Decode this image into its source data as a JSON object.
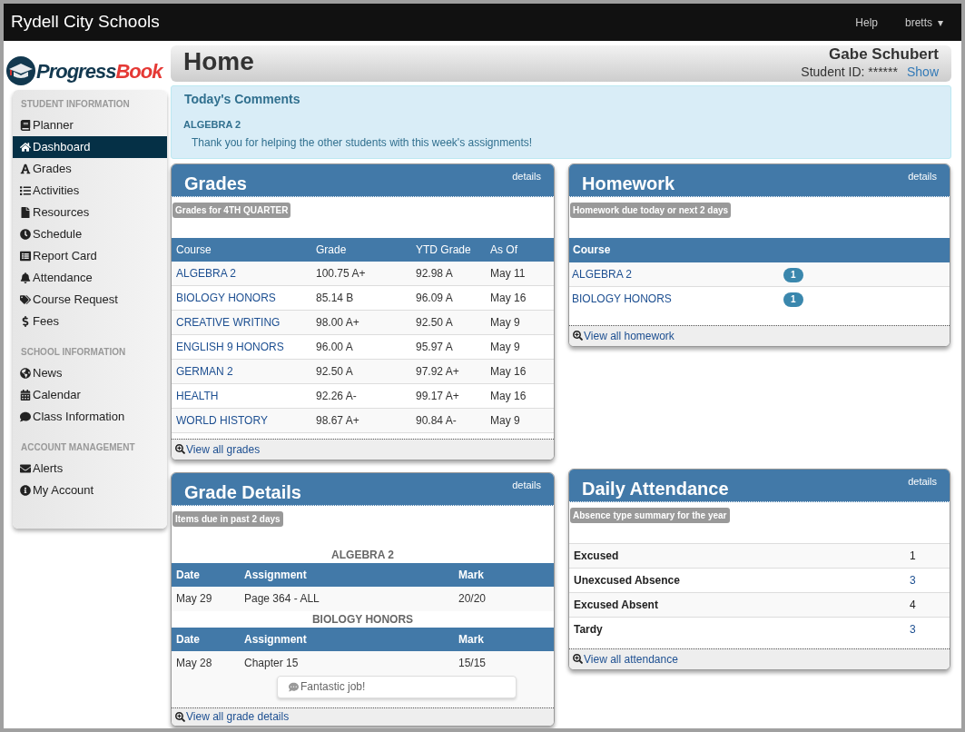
{
  "topbar": {
    "title": "Rydell City Schools",
    "links": [
      "Help"
    ],
    "user": "bretts",
    "caret": "▾"
  },
  "logo": {
    "first": "Progress",
    "second": "Book"
  },
  "sidebar": {
    "sections": [
      {
        "heading": "STUDENT INFORMATION",
        "items": [
          {
            "label": "Planner",
            "selected": false
          },
          {
            "label": "Dashboard",
            "selected": true
          },
          {
            "label": "Grades",
            "selected": false
          },
          {
            "label": "Activities",
            "selected": false
          },
          {
            "label": "Resources",
            "selected": false
          },
          {
            "label": "Schedule",
            "selected": false
          },
          {
            "label": "Report Card",
            "selected": false
          },
          {
            "label": "Attendance",
            "selected": false
          },
          {
            "label": "Course Request",
            "selected": false
          },
          {
            "label": "Fees",
            "selected": false
          }
        ]
      },
      {
        "heading": "SCHOOL INFORMATION",
        "items": [
          {
            "label": "News",
            "selected": false
          },
          {
            "label": "Calendar",
            "selected": false
          },
          {
            "label": "Class Information",
            "selected": false
          }
        ]
      },
      {
        "heading": "ACCOUNT MANAGEMENT",
        "items": [
          {
            "label": "Alerts",
            "selected": false
          },
          {
            "label": "My Account",
            "selected": false
          }
        ]
      }
    ]
  },
  "header": {
    "title": "Home",
    "student": "Gabe Schubert",
    "id_label": "Student ID: ******",
    "show": "Show"
  },
  "comments": {
    "title": "Today's Comments",
    "course": "ALGEBRA 2",
    "text": "Thank you for helping the other students with this week's assignments!"
  },
  "grades": {
    "title": "Grades",
    "details": "details",
    "subtitle": "Grades for 4TH QUARTER",
    "columns": [
      "Course",
      "Grade",
      "YTD Grade",
      "As Of"
    ],
    "rows": [
      [
        "ALGEBRA 2",
        "100.75 A+",
        "92.98 A",
        "May 11"
      ],
      [
        "BIOLOGY HONORS",
        "85.14 B",
        "96.09 A",
        "May 16"
      ],
      [
        "CREATIVE WRITING",
        "98.00 A+",
        "92.50 A",
        "May 9"
      ],
      [
        "ENGLISH 9 HONORS",
        "96.00 A",
        "95.97 A",
        "May 9"
      ],
      [
        "GERMAN 2",
        "92.50 A",
        "97.92 A+",
        "May 16"
      ],
      [
        "HEALTH",
        "92.26 A-",
        "99.17 A+",
        "May 16"
      ],
      [
        "WORLD HISTORY",
        "98.67 A+",
        "90.84 A-",
        "May 9"
      ]
    ],
    "footer": "View all grades"
  },
  "homework": {
    "title": "Homework",
    "details": "details",
    "subtitle": "Homework due today or next 2 days",
    "columns": [
      "Course"
    ],
    "rows": [
      {
        "course": "ALGEBRA 2",
        "count": "1"
      },
      {
        "course": "BIOLOGY HONORS",
        "count": "1"
      }
    ],
    "footer": "View all homework"
  },
  "grade_details": {
    "title": "Grade Details",
    "details": "details",
    "subtitle": "Items due in past 2 days",
    "groups": [
      {
        "course": "ALGEBRA 2",
        "columns": [
          "Date",
          "Assignment",
          "Mark"
        ],
        "rows": [
          {
            "date": "May 29",
            "assignment": "Page 364 - ALL",
            "mark": "20/20"
          }
        ]
      },
      {
        "course": "BIOLOGY HONORS",
        "columns": [
          "Date",
          "Assignment",
          "Mark"
        ],
        "rows": [
          {
            "date": "May 28",
            "assignment": "Chapter 15",
            "mark": "15/15",
            "comment": "Fantastic job!"
          }
        ]
      }
    ],
    "footer": "View all grade details"
  },
  "attendance": {
    "title": "Daily Attendance",
    "details": "details",
    "subtitle": "Absence type summary for the year",
    "rows": [
      {
        "type": "Excused",
        "count": "1",
        "link": false
      },
      {
        "type": "Unexcused Absence",
        "count": "3",
        "link": true
      },
      {
        "type": "Excused Absent",
        "count": "4",
        "link": false
      },
      {
        "type": "Tardy",
        "count": "3",
        "link": true
      }
    ],
    "footer": "View all attendance"
  }
}
